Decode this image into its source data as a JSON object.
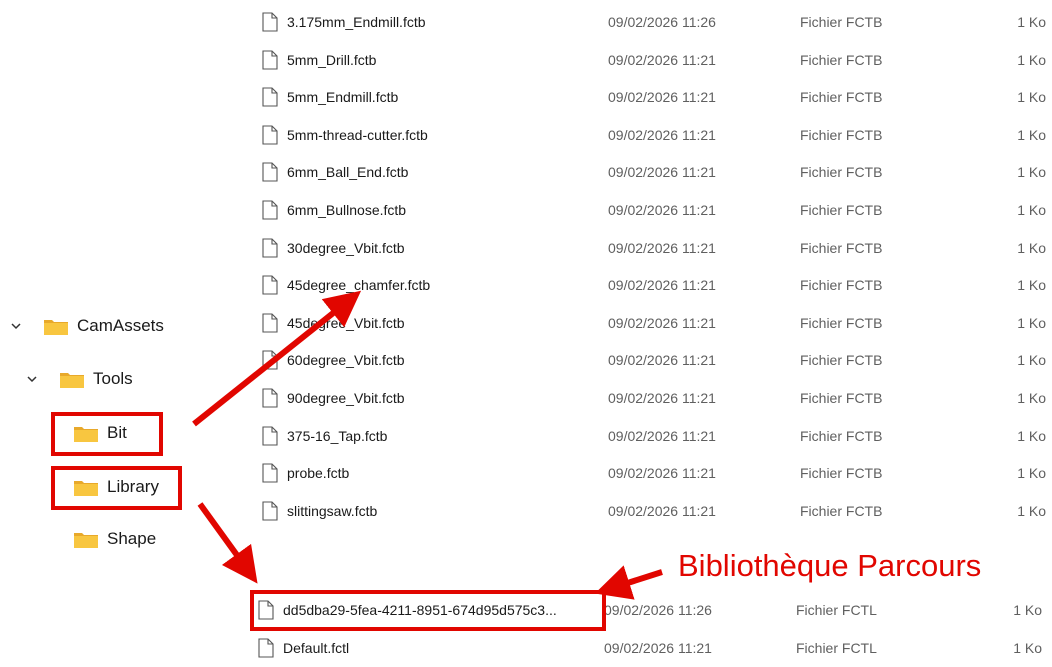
{
  "tree": {
    "items": [
      {
        "label": "CamAssets",
        "expanded": true
      },
      {
        "label": "Tools",
        "expanded": true
      },
      {
        "label": "Bit"
      },
      {
        "label": "Library"
      },
      {
        "label": "Shape"
      }
    ]
  },
  "bit_files": [
    {
      "name": "3.175mm_Endmill.fctb",
      "date": "09/02/2026 11:26",
      "type": "Fichier FCTB",
      "size": "1 Ko"
    },
    {
      "name": "5mm_Drill.fctb",
      "date": "09/02/2026 11:21",
      "type": "Fichier FCTB",
      "size": "1 Ko"
    },
    {
      "name": "5mm_Endmill.fctb",
      "date": "09/02/2026 11:21",
      "type": "Fichier FCTB",
      "size": "1 Ko"
    },
    {
      "name": "5mm-thread-cutter.fctb",
      "date": "09/02/2026 11:21",
      "type": "Fichier FCTB",
      "size": "1 Ko"
    },
    {
      "name": "6mm_Ball_End.fctb",
      "date": "09/02/2026 11:21",
      "type": "Fichier FCTB",
      "size": "1 Ko"
    },
    {
      "name": "6mm_Bullnose.fctb",
      "date": "09/02/2026 11:21",
      "type": "Fichier FCTB",
      "size": "1 Ko"
    },
    {
      "name": "30degree_Vbit.fctb",
      "date": "09/02/2026 11:21",
      "type": "Fichier FCTB",
      "size": "1 Ko"
    },
    {
      "name": "45degree_chamfer.fctb",
      "date": "09/02/2026 11:21",
      "type": "Fichier FCTB",
      "size": "1 Ko"
    },
    {
      "name": "45degree_Vbit.fctb",
      "date": "09/02/2026 11:21",
      "type": "Fichier FCTB",
      "size": "1 Ko"
    },
    {
      "name": "60degree_Vbit.fctb",
      "date": "09/02/2026 11:21",
      "type": "Fichier FCTB",
      "size": "1 Ko"
    },
    {
      "name": "90degree_Vbit.fctb",
      "date": "09/02/2026 11:21",
      "type": "Fichier FCTB",
      "size": "1 Ko"
    },
    {
      "name": "375-16_Tap.fctb",
      "date": "09/02/2026 11:21",
      "type": "Fichier FCTB",
      "size": "1 Ko"
    },
    {
      "name": "probe.fctb",
      "date": "09/02/2026 11:21",
      "type": "Fichier FCTB",
      "size": "1 Ko"
    },
    {
      "name": "slittingsaw.fctb",
      "date": "09/02/2026 11:21",
      "type": "Fichier FCTB",
      "size": "1 Ko"
    }
  ],
  "library_files": [
    {
      "name": "dd5dba29-5fea-4211-8951-674d95d575c3...",
      "date": "09/02/2026 11:26",
      "type": "Fichier FCTL",
      "size": "1 Ko"
    },
    {
      "name": "Default.fctl",
      "date": "09/02/2026 11:21",
      "type": "Fichier FCTL",
      "size": "1 Ko"
    }
  ],
  "annotation": {
    "callout_text": "Bibliothèque Parcours",
    "color": "#e10600"
  },
  "icons": {
    "folder": "folder-icon",
    "file": "file-icon",
    "chevron": "chevron-down-icon"
  },
  "colors": {
    "folder_fill": "#f8c640",
    "folder_tab": "#e8a92b",
    "annotation_red": "#e10600"
  }
}
